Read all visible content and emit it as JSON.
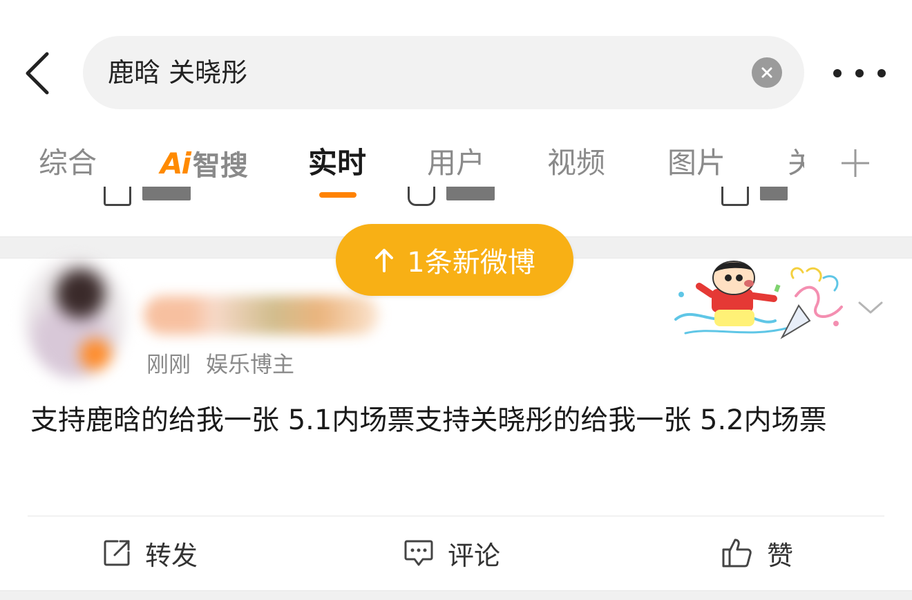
{
  "search": {
    "query": "鹿晗 关晓彤"
  },
  "tabs": {
    "items": [
      {
        "label": "综合"
      },
      {
        "label": "智搜",
        "logo": "Ai"
      },
      {
        "label": "实时",
        "active": true
      },
      {
        "label": "用户"
      },
      {
        "label": "视频"
      },
      {
        "label": "图片"
      },
      {
        "label": "关"
      }
    ]
  },
  "new_posts_pill": {
    "label": "1条新微博"
  },
  "post": {
    "time": "刚刚",
    "source": "娱乐博主",
    "text": "支持鹿晗的给我一张 5.1内场票支持关晓彤的给我一张 5.2内场票",
    "actions": {
      "repost": "转发",
      "comment": "评论",
      "like": "赞"
    }
  },
  "colors": {
    "accent": "#ff8200",
    "pill": "#f8b015",
    "inactive_text": "#8a8a8a"
  },
  "icons": [
    "back-arrow-icon",
    "clear-icon",
    "more-icon",
    "add-tab-icon",
    "repost-icon",
    "comment-icon",
    "like-icon",
    "chevron-down-icon",
    "arrow-up-icon"
  ]
}
